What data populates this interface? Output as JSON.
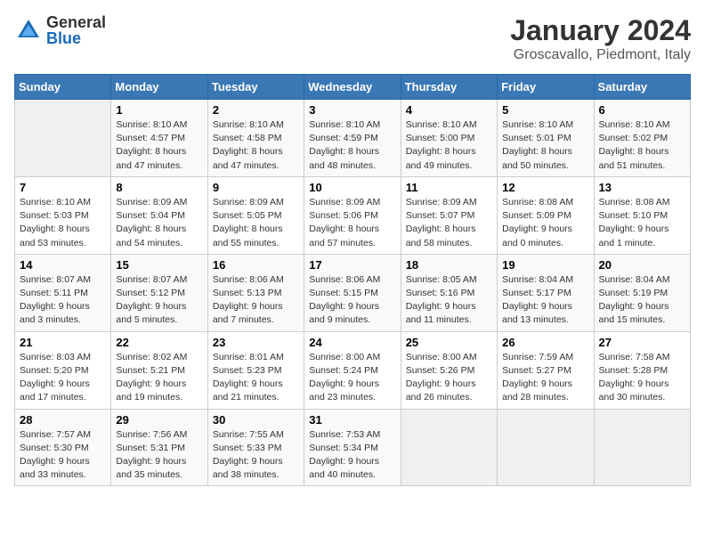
{
  "logo": {
    "general": "General",
    "blue": "Blue"
  },
  "title": "January 2024",
  "location": "Groscavallo, Piedmont, Italy",
  "weekdays": [
    "Sunday",
    "Monday",
    "Tuesday",
    "Wednesday",
    "Thursday",
    "Friday",
    "Saturday"
  ],
  "weeks": [
    [
      {
        "day": null
      },
      {
        "day": "1",
        "sunrise": "Sunrise: 8:10 AM",
        "sunset": "Sunset: 4:57 PM",
        "daylight": "Daylight: 8 hours and 47 minutes."
      },
      {
        "day": "2",
        "sunrise": "Sunrise: 8:10 AM",
        "sunset": "Sunset: 4:58 PM",
        "daylight": "Daylight: 8 hours and 47 minutes."
      },
      {
        "day": "3",
        "sunrise": "Sunrise: 8:10 AM",
        "sunset": "Sunset: 4:59 PM",
        "daylight": "Daylight: 8 hours and 48 minutes."
      },
      {
        "day": "4",
        "sunrise": "Sunrise: 8:10 AM",
        "sunset": "Sunset: 5:00 PM",
        "daylight": "Daylight: 8 hours and 49 minutes."
      },
      {
        "day": "5",
        "sunrise": "Sunrise: 8:10 AM",
        "sunset": "Sunset: 5:01 PM",
        "daylight": "Daylight: 8 hours and 50 minutes."
      },
      {
        "day": "6",
        "sunrise": "Sunrise: 8:10 AM",
        "sunset": "Sunset: 5:02 PM",
        "daylight": "Daylight: 8 hours and 51 minutes."
      }
    ],
    [
      {
        "day": "7",
        "sunrise": "Sunrise: 8:10 AM",
        "sunset": "Sunset: 5:03 PM",
        "daylight": "Daylight: 8 hours and 53 minutes."
      },
      {
        "day": "8",
        "sunrise": "Sunrise: 8:09 AM",
        "sunset": "Sunset: 5:04 PM",
        "daylight": "Daylight: 8 hours and 54 minutes."
      },
      {
        "day": "9",
        "sunrise": "Sunrise: 8:09 AM",
        "sunset": "Sunset: 5:05 PM",
        "daylight": "Daylight: 8 hours and 55 minutes."
      },
      {
        "day": "10",
        "sunrise": "Sunrise: 8:09 AM",
        "sunset": "Sunset: 5:06 PM",
        "daylight": "Daylight: 8 hours and 57 minutes."
      },
      {
        "day": "11",
        "sunrise": "Sunrise: 8:09 AM",
        "sunset": "Sunset: 5:07 PM",
        "daylight": "Daylight: 8 hours and 58 minutes."
      },
      {
        "day": "12",
        "sunrise": "Sunrise: 8:08 AM",
        "sunset": "Sunset: 5:09 PM",
        "daylight": "Daylight: 9 hours and 0 minutes."
      },
      {
        "day": "13",
        "sunrise": "Sunrise: 8:08 AM",
        "sunset": "Sunset: 5:10 PM",
        "daylight": "Daylight: 9 hours and 1 minute."
      }
    ],
    [
      {
        "day": "14",
        "sunrise": "Sunrise: 8:07 AM",
        "sunset": "Sunset: 5:11 PM",
        "daylight": "Daylight: 9 hours and 3 minutes."
      },
      {
        "day": "15",
        "sunrise": "Sunrise: 8:07 AM",
        "sunset": "Sunset: 5:12 PM",
        "daylight": "Daylight: 9 hours and 5 minutes."
      },
      {
        "day": "16",
        "sunrise": "Sunrise: 8:06 AM",
        "sunset": "Sunset: 5:13 PM",
        "daylight": "Daylight: 9 hours and 7 minutes."
      },
      {
        "day": "17",
        "sunrise": "Sunrise: 8:06 AM",
        "sunset": "Sunset: 5:15 PM",
        "daylight": "Daylight: 9 hours and 9 minutes."
      },
      {
        "day": "18",
        "sunrise": "Sunrise: 8:05 AM",
        "sunset": "Sunset: 5:16 PM",
        "daylight": "Daylight: 9 hours and 11 minutes."
      },
      {
        "day": "19",
        "sunrise": "Sunrise: 8:04 AM",
        "sunset": "Sunset: 5:17 PM",
        "daylight": "Daylight: 9 hours and 13 minutes."
      },
      {
        "day": "20",
        "sunrise": "Sunrise: 8:04 AM",
        "sunset": "Sunset: 5:19 PM",
        "daylight": "Daylight: 9 hours and 15 minutes."
      }
    ],
    [
      {
        "day": "21",
        "sunrise": "Sunrise: 8:03 AM",
        "sunset": "Sunset: 5:20 PM",
        "daylight": "Daylight: 9 hours and 17 minutes."
      },
      {
        "day": "22",
        "sunrise": "Sunrise: 8:02 AM",
        "sunset": "Sunset: 5:21 PM",
        "daylight": "Daylight: 9 hours and 19 minutes."
      },
      {
        "day": "23",
        "sunrise": "Sunrise: 8:01 AM",
        "sunset": "Sunset: 5:23 PM",
        "daylight": "Daylight: 9 hours and 21 minutes."
      },
      {
        "day": "24",
        "sunrise": "Sunrise: 8:00 AM",
        "sunset": "Sunset: 5:24 PM",
        "daylight": "Daylight: 9 hours and 23 minutes."
      },
      {
        "day": "25",
        "sunrise": "Sunrise: 8:00 AM",
        "sunset": "Sunset: 5:26 PM",
        "daylight": "Daylight: 9 hours and 26 minutes."
      },
      {
        "day": "26",
        "sunrise": "Sunrise: 7:59 AM",
        "sunset": "Sunset: 5:27 PM",
        "daylight": "Daylight: 9 hours and 28 minutes."
      },
      {
        "day": "27",
        "sunrise": "Sunrise: 7:58 AM",
        "sunset": "Sunset: 5:28 PM",
        "daylight": "Daylight: 9 hours and 30 minutes."
      }
    ],
    [
      {
        "day": "28",
        "sunrise": "Sunrise: 7:57 AM",
        "sunset": "Sunset: 5:30 PM",
        "daylight": "Daylight: 9 hours and 33 minutes."
      },
      {
        "day": "29",
        "sunrise": "Sunrise: 7:56 AM",
        "sunset": "Sunset: 5:31 PM",
        "daylight": "Daylight: 9 hours and 35 minutes."
      },
      {
        "day": "30",
        "sunrise": "Sunrise: 7:55 AM",
        "sunset": "Sunset: 5:33 PM",
        "daylight": "Daylight: 9 hours and 38 minutes."
      },
      {
        "day": "31",
        "sunrise": "Sunrise: 7:53 AM",
        "sunset": "Sunset: 5:34 PM",
        "daylight": "Daylight: 9 hours and 40 minutes."
      },
      {
        "day": null
      },
      {
        "day": null
      },
      {
        "day": null
      }
    ]
  ]
}
